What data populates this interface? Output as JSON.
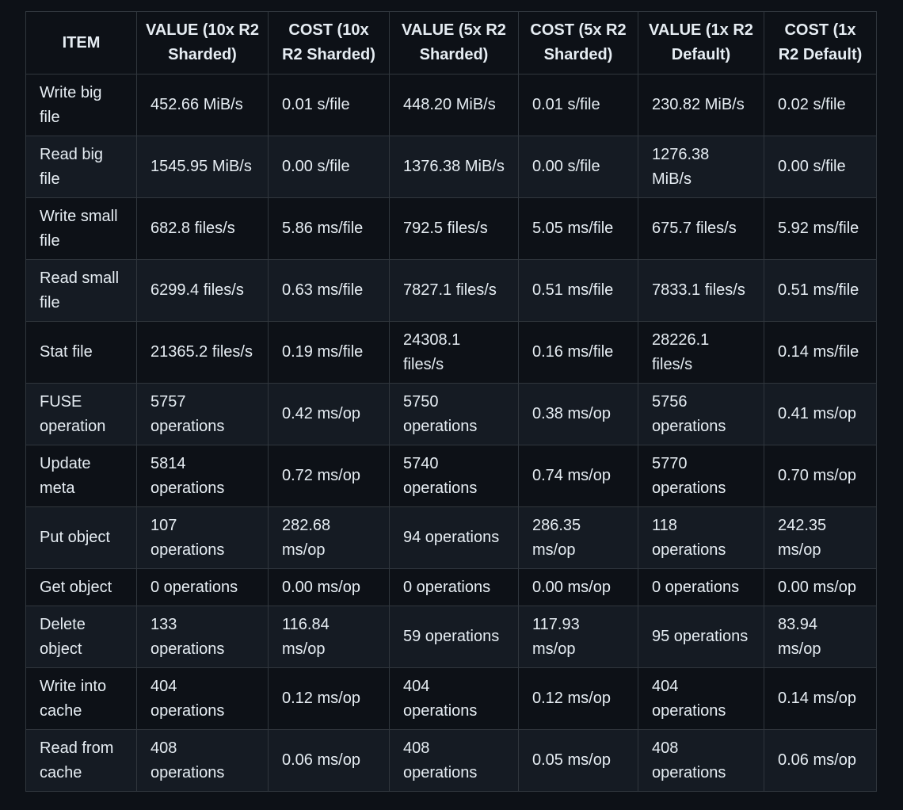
{
  "table": {
    "headers": [
      "ITEM",
      "VALUE (10x R2 Sharded)",
      "COST (10x R2 Sharded)",
      "VALUE (5x R2 Sharded)",
      "COST (5x R2 Sharded)",
      "VALUE (1x R2 Default)",
      "COST (1x R2 Default)"
    ],
    "rows": [
      [
        "Write big file",
        "452.66 MiB/s",
        "0.01 s/file",
        "448.20 MiB/s",
        "0.01 s/file",
        "230.82 MiB/s",
        "0.02 s/file"
      ],
      [
        "Read big file",
        "1545.95 MiB/s",
        "0.00 s/file",
        "1376.38 MiB/s",
        "0.00 s/file",
        "1276.38 MiB/s",
        "0.00 s/file"
      ],
      [
        "Write small file",
        "682.8 files/s",
        "5.86 ms/file",
        "792.5 files/s",
        "5.05 ms/file",
        "675.7 files/s",
        "5.92 ms/file"
      ],
      [
        "Read small file",
        "6299.4 files/s",
        "0.63 ms/file",
        "7827.1 files/s",
        "0.51 ms/file",
        "7833.1 files/s",
        "0.51 ms/file"
      ],
      [
        "Stat file",
        "21365.2 files/s",
        "0.19 ms/file",
        "24308.1 files/s",
        "0.16 ms/file",
        "28226.1 files/s",
        "0.14 ms/file"
      ],
      [
        "FUSE operation",
        "5757 operations",
        "0.42 ms/op",
        "5750 operations",
        "0.38 ms/op",
        "5756 operations",
        "0.41 ms/op"
      ],
      [
        "Update meta",
        "5814 operations",
        "0.72 ms/op",
        "5740 operations",
        "0.74 ms/op",
        "5770 operations",
        "0.70 ms/op"
      ],
      [
        "Put object",
        "107 operations",
        "282.68 ms/op",
        "94 operations",
        "286.35 ms/op",
        "118 operations",
        "242.35 ms/op"
      ],
      [
        "Get object",
        "0 operations",
        "0.00 ms/op",
        "0 operations",
        "0.00 ms/op",
        "0 operations",
        "0.00 ms/op"
      ],
      [
        "Delete object",
        "133 operations",
        "116.84 ms/op",
        "59 operations",
        "117.93 ms/op",
        "95 operations",
        "83.94 ms/op"
      ],
      [
        "Write into cache",
        "404 operations",
        "0.12 ms/op",
        "404 operations",
        "0.12 ms/op",
        "404 operations",
        "0.14 ms/op"
      ],
      [
        "Read from cache",
        "408 operations",
        "0.06 ms/op",
        "408 operations",
        "0.05 ms/op",
        "408 operations",
        "0.06 ms/op"
      ]
    ]
  }
}
